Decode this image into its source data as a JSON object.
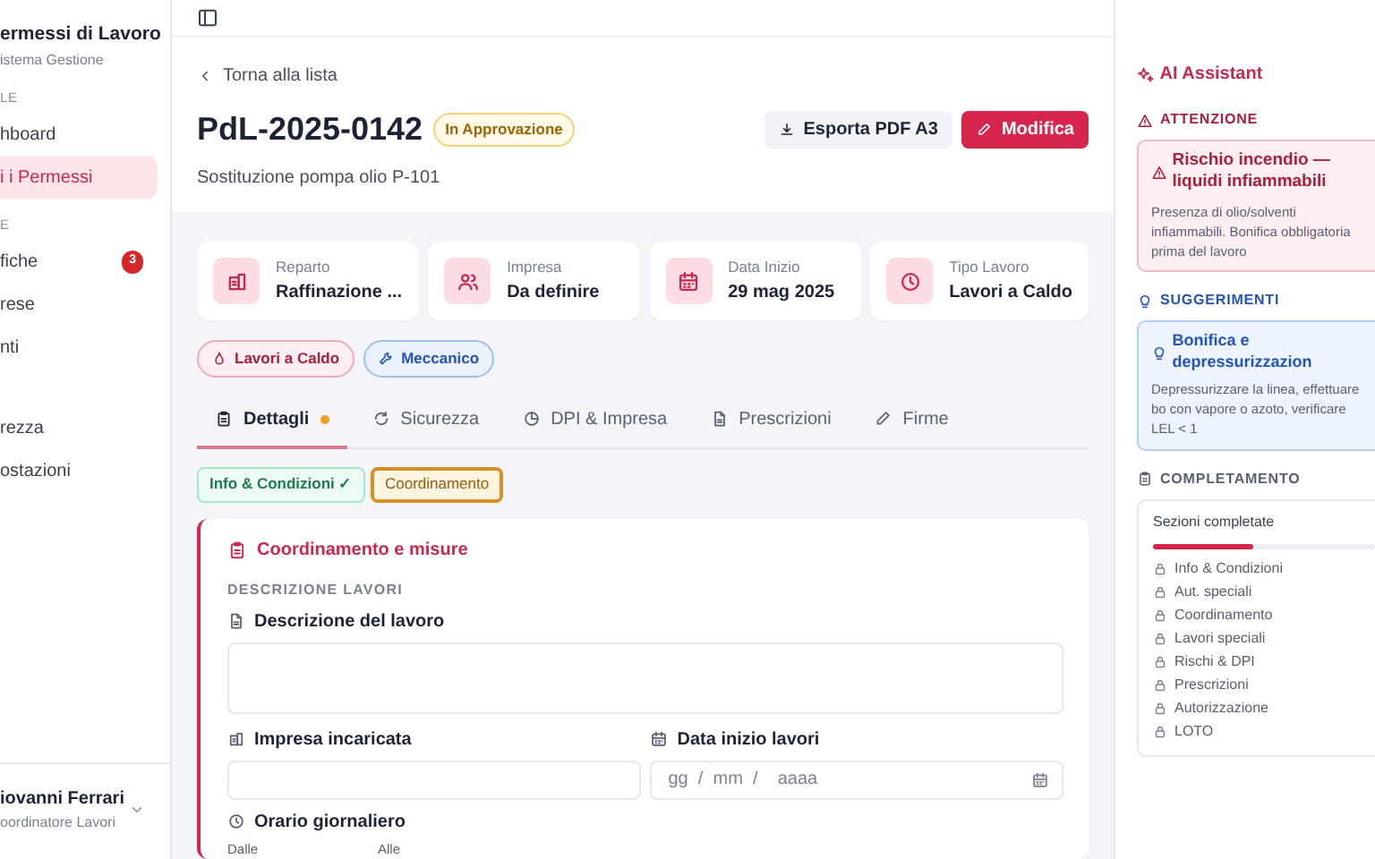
{
  "sidebar": {
    "title": "ermessi di Lavoro",
    "subtitle": "istema Gestione",
    "sections": [
      {
        "label": "LE",
        "items": [
          {
            "label": "hboard",
            "selected": false
          },
          {
            "label": "i i Permessi",
            "selected": true
          }
        ]
      },
      {
        "label": "E",
        "items": [
          {
            "label": "fiche",
            "selected": false,
            "badge": "3"
          },
          {
            "label": "rese",
            "selected": false
          },
          {
            "label": "nti",
            "selected": false
          }
        ]
      },
      {
        "items": [
          {
            "label": "rezza",
            "selected": false
          },
          {
            "label": "ostazioni",
            "selected": false
          }
        ]
      }
    ],
    "user": {
      "name": "iovanni Ferrari",
      "role": "oordinatore Lavori"
    }
  },
  "header": {
    "back": "Torna alla lista",
    "title": "PdL-2025-0142",
    "status": "In Approvazione",
    "subtitle": "Sostituzione pompa olio P-101",
    "buttons": [
      {
        "label": "Esporta PDF A3",
        "kind": "secondary"
      },
      {
        "label": "Modifica",
        "kind": "primary"
      }
    ]
  },
  "info_cards": [
    {
      "kind": "building",
      "label": "Reparto",
      "value": "Raffinazione ..."
    },
    {
      "kind": "people",
      "label": "Impresa",
      "value": "Da definire"
    },
    {
      "kind": "calendar",
      "label": "Data Inizio",
      "value": "29 mag 2025"
    },
    {
      "kind": "clock",
      "label": "Tipo Lavoro",
      "value": "Lavori a Caldo"
    }
  ],
  "tags": [
    {
      "label": "Lavori a Caldo",
      "kind": "danger"
    },
    {
      "label": "Meccanico",
      "kind": "info"
    }
  ],
  "tabs": [
    {
      "label": "Dettagli",
      "selected": true,
      "dot": true
    },
    {
      "label": "Sicurezza",
      "selected": false,
      "dot": false
    },
    {
      "label": "DPI & Impresa",
      "selected": false,
      "dot": false
    },
    {
      "label": "Prescrizioni",
      "selected": false,
      "dot": false
    },
    {
      "label": "Firme",
      "selected": false,
      "dot": false
    }
  ],
  "steps": [
    {
      "label": "Info & Condizioni ✓",
      "completed": true,
      "selected": false
    },
    {
      "label": "Coordinamento",
      "completed": false,
      "selected": true
    }
  ],
  "form": {
    "title": "Coordinamento e misure",
    "section": "DESCRIZIONE LAVORI",
    "description_label": "Descrizione del lavoro",
    "company_label": "Impresa incaricata",
    "date_label": "Data inizio lavori",
    "date_placeholder": "gg  /  mm  /    aaaa",
    "hours_label": "Orario giornaliero",
    "from_label": "Dalle",
    "to_label": "Alle"
  },
  "assistant": {
    "title": "AI Assistant",
    "warning": {
      "heading": "ATTENZIONE",
      "title": "Rischio incendio — liquidi infiammabili",
      "text": "Presenza di olio/solventi infiammabili. Bonifica obbligatoria prima del lavoro"
    },
    "suggestion": {
      "heading": "SUGGERIMENTI",
      "title": "Bonifica e depressurizzazion",
      "text": "Depressurizzare la linea, effettuare bo con vapore o azoto, verificare LEL < 1"
    },
    "completion": {
      "heading": "COMPLETAMENTO",
      "label": "Sezioni completate",
      "level": 0.45,
      "items": [
        "Info & Condizioni",
        "Aut. speciali",
        "Coordinamento",
        "Lavori speciali",
        "Rischi & DPI",
        "Prescrizioni",
        "Autorizzazione",
        "LOTO"
      ]
    }
  }
}
